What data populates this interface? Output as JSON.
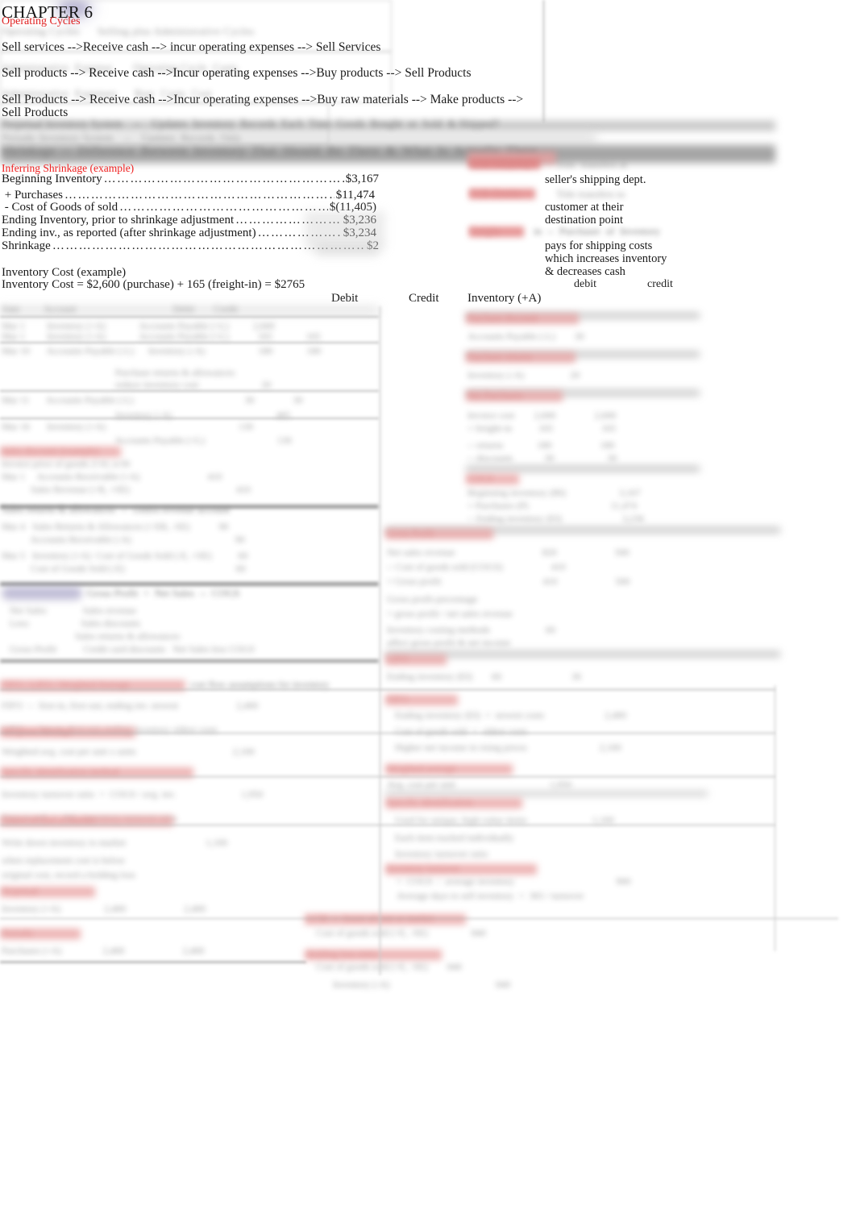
{
  "document": {
    "title": "CHAPTER 6",
    "subtitle": "Operating Cycles",
    "accent_red": "#e02020",
    "accent_section_red": "#ef2020",
    "highlight_purple": "#8b86b4",
    "body_color": "#1a1a1a",
    "page_background": "#ffffff"
  },
  "operating_cycles": {
    "line1": "Sell services -->Receive cash --> incur operating expenses --> Sell Services",
    "line2": "Sell products --> Receive cash -->Incur operating expenses -->Buy products --> Sell Products",
    "line3": "Sell Products --> Receive cash -->Incur operating expenses -->Buy raw materials --> Make products -->",
    "line3_cont": "Sell Products"
  },
  "shrinkage": {
    "heading": "Inferring Shrinkage (example)",
    "rows": [
      {
        "label": "Beginning Inventory",
        "value": "$3,167"
      },
      {
        "label": " + Purchases",
        "value": "$11,474"
      },
      {
        "label": " - Cost of Goods of sold",
        "value": "$(11,405)"
      },
      {
        "label": "Ending Inventory, prior to shrinkage adjustment",
        "value": "$3,236"
      },
      {
        "label": "Ending inv., as reported (after shrinkage adjustment)",
        "value": "$3,234"
      },
      {
        "label": "Shrinkage",
        "value": "$2"
      }
    ]
  },
  "inventory_cost": {
    "heading": "Inventory Cost (example)",
    "formula": "Inventory Cost = $2,600 (purchase) + 165 (freight-in) = $2765"
  },
  "journal_headers": {
    "debit": "Debit",
    "credit": "Credit",
    "inventory_account": "Inventory (+A)"
  },
  "shipping_notes": {
    "note1": "seller's shipping dept.",
    "note2_line1": "customer at their",
    "note2_line2": "destination point",
    "note3_line1": "pays for shipping costs",
    "note3_line2": "which increases inventory",
    "note3_line3": "& decreases cash",
    "debit_label": "debit",
    "credit_label": "credit"
  }
}
